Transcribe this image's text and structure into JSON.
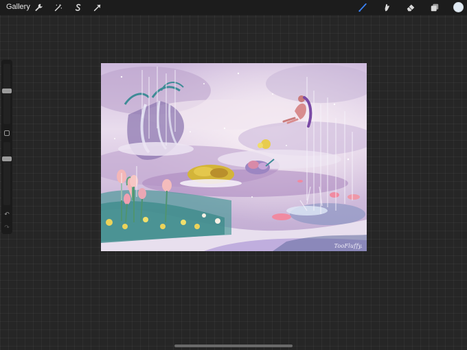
{
  "app": {
    "gallery_label": "Gallery"
  },
  "toolbar_left": [
    {
      "icon": "wrench-icon",
      "name": "actions"
    },
    {
      "icon": "magic-wand-icon",
      "name": "adjustments"
    },
    {
      "icon": "selection-s-icon",
      "name": "selection"
    },
    {
      "icon": "arrow-cursor-icon",
      "name": "transform"
    }
  ],
  "toolbar_right": [
    {
      "icon": "brush-icon",
      "name": "paint",
      "active": true
    },
    {
      "icon": "smudge-icon",
      "name": "smudge"
    },
    {
      "icon": "eraser-icon",
      "name": "eraser"
    },
    {
      "icon": "layers-icon",
      "name": "layers"
    }
  ],
  "colors": {
    "active_tool": "#3b82f6",
    "current_color": "#dfe9f2"
  },
  "sidebar": {
    "brush_size_level": 0.55,
    "opacity_level": 0.25
  },
  "artwork": {
    "signature": "TooFluffy."
  }
}
